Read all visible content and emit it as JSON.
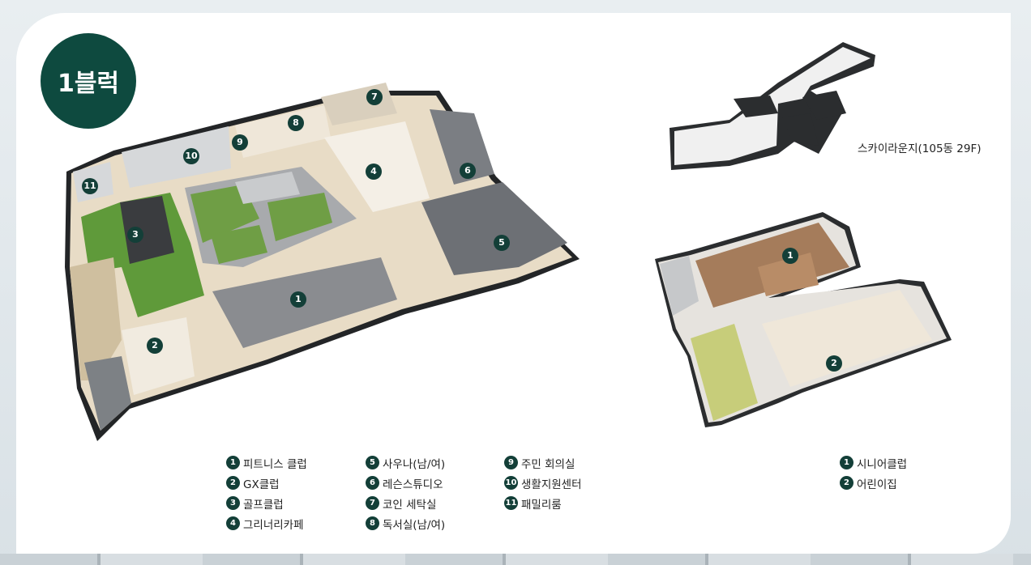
{
  "block_title": "1블럭",
  "sky_lounge_label": "스카이라운지(105동 29F)",
  "main_plan_markers": [
    "1",
    "2",
    "3",
    "4",
    "5",
    "6",
    "7",
    "8",
    "9",
    "10",
    "11"
  ],
  "right_plan_markers": [
    "1",
    "2"
  ],
  "legend_main": [
    {
      "num": "1",
      "label": "피트니스 클럽"
    },
    {
      "num": "2",
      "label": "GX클럽"
    },
    {
      "num": "3",
      "label": "골프클럽"
    },
    {
      "num": "4",
      "label": "그리너리카페"
    },
    {
      "num": "5",
      "label": "사우나(남/여)"
    },
    {
      "num": "6",
      "label": "레슨스튜디오"
    },
    {
      "num": "7",
      "label": "코인 세탁실"
    },
    {
      "num": "8",
      "label": "독서실(남/여)"
    },
    {
      "num": "9",
      "label": "주민 회의실"
    },
    {
      "num": "10",
      "label": "생활지원센터"
    },
    {
      "num": "11",
      "label": "패밀리룸"
    }
  ],
  "legend_right": [
    {
      "num": "1",
      "label": "시니어클럽"
    },
    {
      "num": "2",
      "label": "어린이집"
    }
  ],
  "colors": {
    "accent": "#0e4a3f",
    "turf": "#5f9a3a",
    "floor": "#e9dcc5",
    "wall": "#2d2f31"
  }
}
